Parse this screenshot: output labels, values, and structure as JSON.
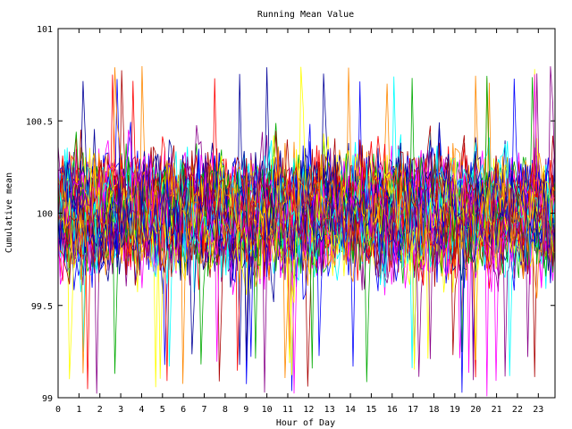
{
  "chart_data": {
    "type": "line",
    "title": "Running Mean Value",
    "xlabel": "Hour of Day",
    "ylabel": "Cumulative mean",
    "xlim": [
      0,
      23.8
    ],
    "ylim": [
      99,
      101
    ],
    "x_ticks": [
      0,
      1,
      2,
      3,
      4,
      5,
      6,
      7,
      8,
      9,
      10,
      11,
      12,
      13,
      14,
      15,
      16,
      17,
      18,
      19,
      20,
      21,
      22,
      23
    ],
    "y_ticks": [
      99,
      99.5,
      100,
      100.5,
      101
    ],
    "y_tick_labels": [
      "99",
      "99.5",
      "100",
      "100.5",
      "101"
    ],
    "grid": false,
    "legend": "none",
    "num_series": 60,
    "samples_per_series": 220,
    "center_value": 100,
    "typical_band": [
      99.6,
      100.45
    ],
    "observed_extremes": [
      99,
      100.8
    ],
    "series_colors": [
      "#ff0000",
      "#00aa00",
      "#0000ff",
      "#ff00ff",
      "#00ffff",
      "#ffff00",
      "#aa0000",
      "#000099",
      "#ff8800",
      "#880088"
    ]
  }
}
